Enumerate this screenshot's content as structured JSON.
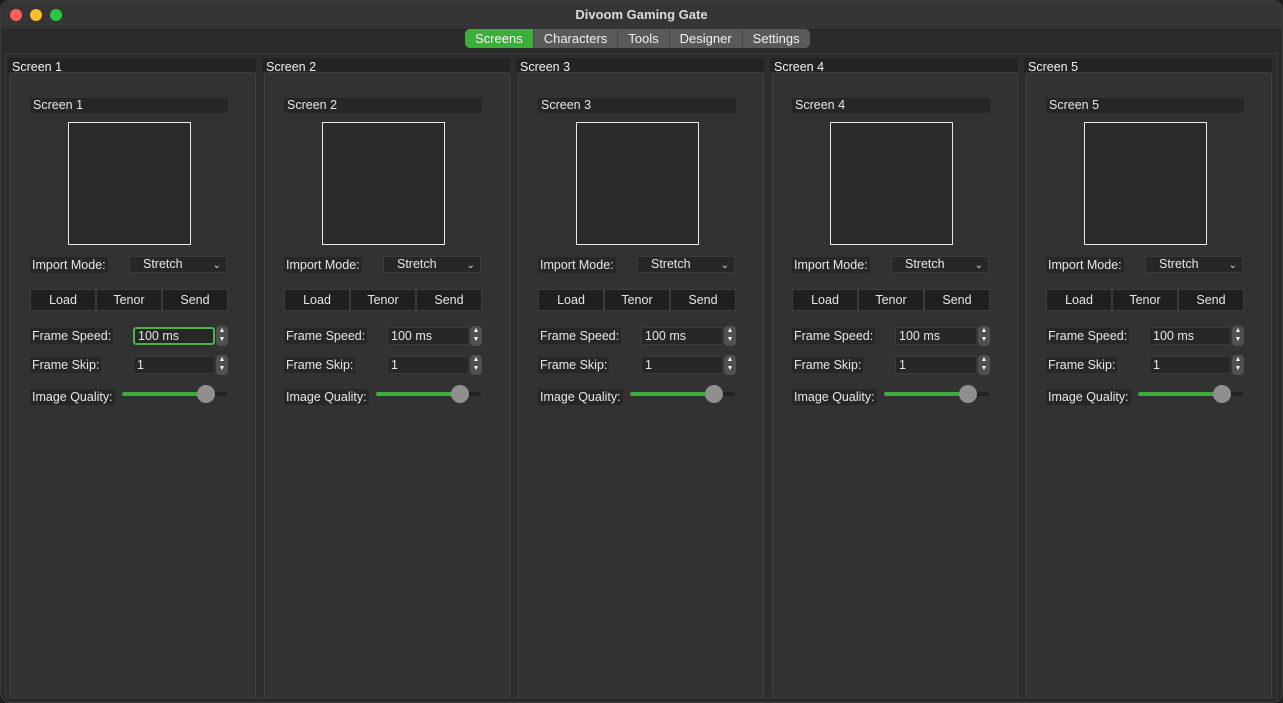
{
  "window": {
    "title": "Divoom Gaming Gate"
  },
  "tabs": [
    {
      "label": "Screens",
      "active": true
    },
    {
      "label": "Characters",
      "active": false
    },
    {
      "label": "Tools",
      "active": false
    },
    {
      "label": "Designer",
      "active": false
    },
    {
      "label": "Settings",
      "active": false
    }
  ],
  "colors": {
    "accent": "#3cae3a"
  },
  "screens": [
    {
      "header": "Screen 1",
      "name": "Screen 1",
      "import_mode_label": "Import Mode:",
      "import_mode": "Stretch",
      "buttons": [
        "Load",
        "Tenor",
        "Send"
      ],
      "frame_speed_label": "Frame Speed:",
      "frame_speed": "100 ms",
      "frame_skip_label": "Frame Skip:",
      "frame_skip": "1",
      "image_quality_label": "Image Quality:",
      "image_quality": 0.8
    },
    {
      "header": "Screen 2",
      "name": "Screen 2",
      "import_mode_label": "Import Mode:",
      "import_mode": "Stretch",
      "buttons": [
        "Load",
        "Tenor",
        "Send"
      ],
      "frame_speed_label": "Frame Speed:",
      "frame_speed": "100 ms",
      "frame_skip_label": "Frame Skip:",
      "frame_skip": "1",
      "image_quality_label": "Image Quality:",
      "image_quality": 0.8
    },
    {
      "header": "Screen 3",
      "name": "Screen 3",
      "import_mode_label": "Import Mode:",
      "import_mode": "Stretch",
      "buttons": [
        "Load",
        "Tenor",
        "Send"
      ],
      "frame_speed_label": "Frame Speed:",
      "frame_speed": "100 ms",
      "frame_skip_label": "Frame Skip:",
      "frame_skip": "1",
      "image_quality_label": "Image Quality:",
      "image_quality": 0.8
    },
    {
      "header": "Screen 4",
      "name": "Screen 4",
      "import_mode_label": "Import Mode:",
      "import_mode": "Stretch",
      "buttons": [
        "Load",
        "Tenor",
        "Send"
      ],
      "frame_speed_label": "Frame Speed:",
      "frame_speed": "100 ms",
      "frame_skip_label": "Frame Skip:",
      "frame_skip": "1",
      "image_quality_label": "Image Quality:",
      "image_quality": 0.8
    },
    {
      "header": "Screen 5",
      "name": "Screen 5",
      "import_mode_label": "Import Mode:",
      "import_mode": "Stretch",
      "buttons": [
        "Load",
        "Tenor",
        "Send"
      ],
      "frame_speed_label": "Frame Speed:",
      "frame_speed": "100 ms",
      "frame_skip_label": "Frame Skip:",
      "frame_skip": "1",
      "image_quality_label": "Image Quality:",
      "image_quality": 0.8
    }
  ]
}
